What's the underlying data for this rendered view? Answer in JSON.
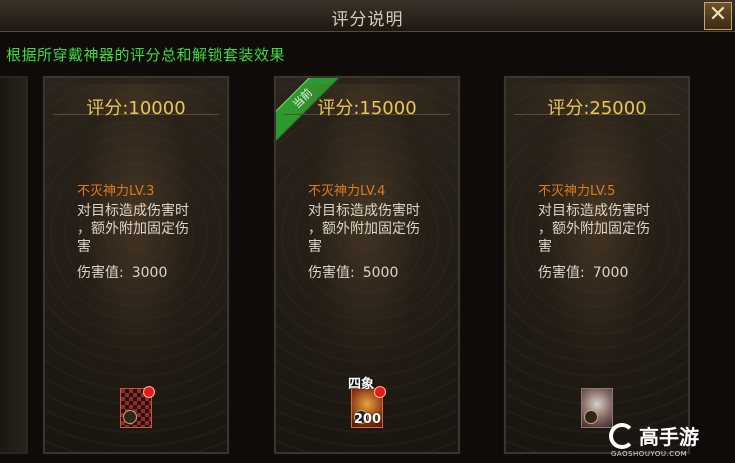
{
  "window": {
    "title": "评分说明",
    "close_glyph": "✕"
  },
  "subtitle": "根据所穿戴神器的评分总和解锁套装效果",
  "cards": [
    {
      "score": "评分:10000",
      "set_name": "不灭神力LV.3",
      "desc_line1": "对目标造成伤害时",
      "desc_line2": "，额外附加固定伤",
      "desc_line3": "害",
      "dmg_label": "伤害值:",
      "dmg_value": "3000",
      "item_icon": "checker-armor-icon"
    },
    {
      "score": "评分:15000",
      "ribbon": "当前",
      "set_name": "不灭神力LV.4",
      "desc_line1": "对目标造成伤害时",
      "desc_line2": "，额外附加固定伤",
      "desc_line3": "害",
      "dmg_label": "伤害值:",
      "dmg_value": "5000",
      "item_tag": "四象",
      "item_count": "200",
      "item_icon": "gold-emblem-icon"
    },
    {
      "score": "评分:25000",
      "set_name": "不灭神力LV.5",
      "desc_line1": "对目标造成伤害时",
      "desc_line2": "，额外附加固定伤",
      "desc_line3": "害",
      "dmg_label": "伤害值:",
      "dmg_value": "7000",
      "item_icon": "helmet-icon"
    }
  ],
  "watermark": {
    "text": "高手游",
    "sub": "GAOSHOUYOU.COM"
  }
}
